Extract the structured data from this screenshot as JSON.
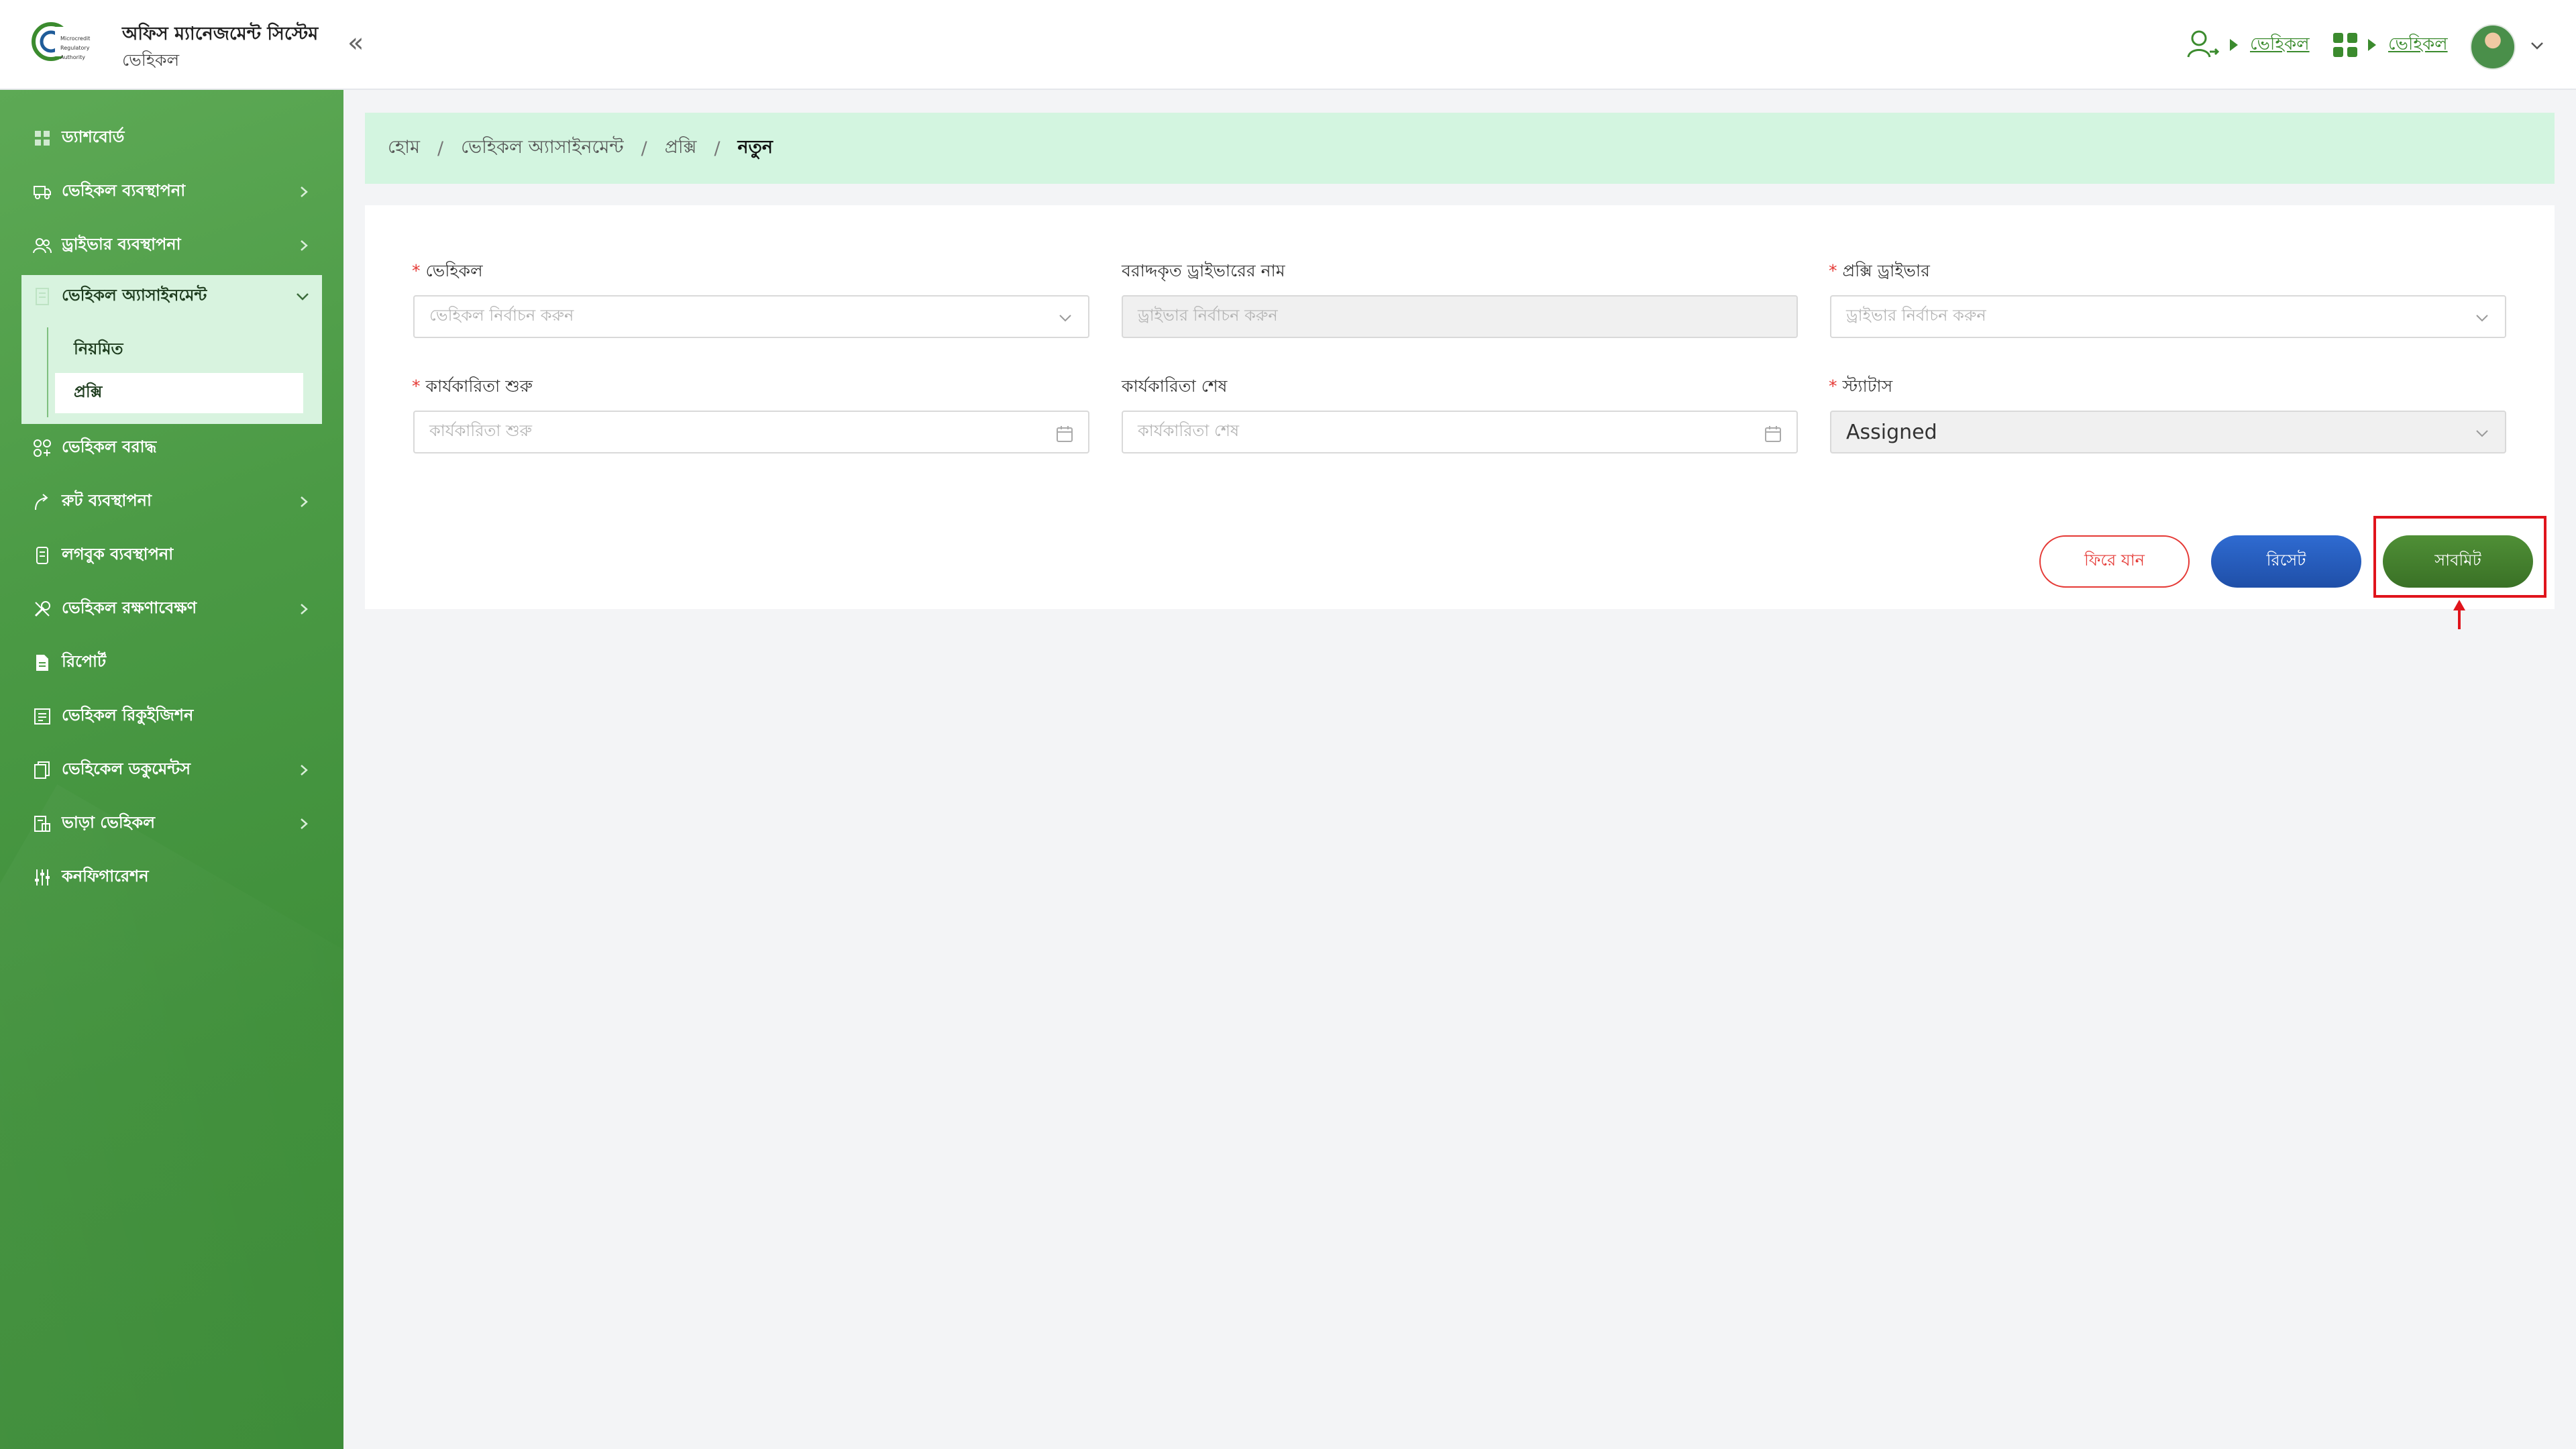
{
  "header": {
    "app_title": "অফিস ম্যানেজমেন্ট সিস্টেম",
    "app_subtitle": "ভেহিকল",
    "role_link": "ভেহিকল",
    "module_link": "ভেহিকল"
  },
  "sidebar": {
    "items": [
      {
        "label": "ড্যাশবোর্ড"
      },
      {
        "label": "ভেহিকল ব্যবস্থাপনা"
      },
      {
        "label": "ড্রাইভার ব্যবস্থাপনা"
      },
      {
        "label": "ভেহিকল অ্যাসাইনমেন্ট"
      },
      {
        "label": "ভেহিকল বরাদ্ধ"
      },
      {
        "label": "রুট ব্যবস্থাপনা"
      },
      {
        "label": "লগবুক ব্যবস্থাপনা"
      },
      {
        "label": "ভেহিকল রক্ষণাবেক্ষণ"
      },
      {
        "label": "রিপোর্ট"
      },
      {
        "label": "ভেহিকল রিকুইজিশন"
      },
      {
        "label": "ভেহিকেল ডকুমেন্টস"
      },
      {
        "label": "ভাড়া ভেহিকল"
      },
      {
        "label": "কনফিগারেশন"
      }
    ],
    "sub_items": [
      {
        "label": "নিয়মিত"
      },
      {
        "label": "প্রক্সি"
      }
    ]
  },
  "breadcrumb": {
    "items": [
      "হোম",
      "ভেহিকল অ্যাসাইনমেন্ট",
      "প্রক্সি"
    ],
    "current": "নতুন",
    "separator": "/"
  },
  "form": {
    "vehicle": {
      "label": "ভেহিকল",
      "placeholder": "ভেহিকল নির্বাচন করুন"
    },
    "assigned_driver": {
      "label": "বরাদ্দকৃত ড্রাইভারের নাম",
      "placeholder": "ড্রাইভার নির্বাচন করুন"
    },
    "proxy_driver": {
      "label": "প্রক্সি ড্রাইভার",
      "placeholder": "ড্রাইভার নির্বাচন করুন"
    },
    "start": {
      "label": "কার্যকারিতা শুরু",
      "placeholder": "কার্যকারিতা শুরু"
    },
    "end": {
      "label": "কার্যকারিতা শেষ",
      "placeholder": "কার্যকারিতা শেষ"
    },
    "status": {
      "label": "স্ট্যাটাস",
      "value": "Assigned"
    },
    "required_mark": "*"
  },
  "buttons": {
    "back": "ফিরে যান",
    "reset": "রিসেট",
    "submit": "সাবমিট"
  },
  "colors": {
    "brand_green": "#3b8b2e",
    "sidebar_green": "#4b9a45",
    "breadcrumb_bg": "#d3f5e0",
    "reset_blue": "#1f4fa8",
    "danger_red": "#e53935",
    "annotation_red": "#e0141c"
  }
}
